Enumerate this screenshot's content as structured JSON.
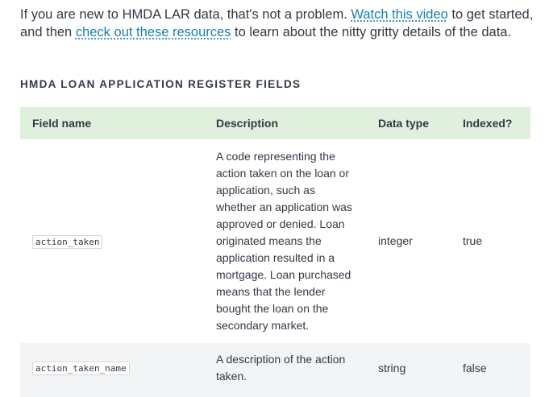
{
  "intro": {
    "text_1": "If you are new to HMDA LAR data, that's not a problem. ",
    "link_1": "Watch this video",
    "text_2": " to get started, and then ",
    "link_2": "check out these resources",
    "text_3": " to learn about the nitty gritty details of the data."
  },
  "section": {
    "heading": "HMDA LOAN APPLICATION REGISTER FIELDS"
  },
  "table": {
    "headers": {
      "field": "Field name",
      "description": "Description",
      "type": "Data type",
      "indexed": "Indexed?"
    },
    "rows": [
      {
        "field": "action_taken",
        "description": "A code representing the action taken on the loan or application, such as whether an application was approved or denied. Loan originated means the application resulted in a mortgage. Loan purchased means that the lender bought the loan on the secondary market.",
        "type": "integer",
        "indexed": "true"
      },
      {
        "field": "action_taken_name",
        "description": "A description of the action taken.",
        "type": "string",
        "indexed": "false"
      }
    ]
  }
}
